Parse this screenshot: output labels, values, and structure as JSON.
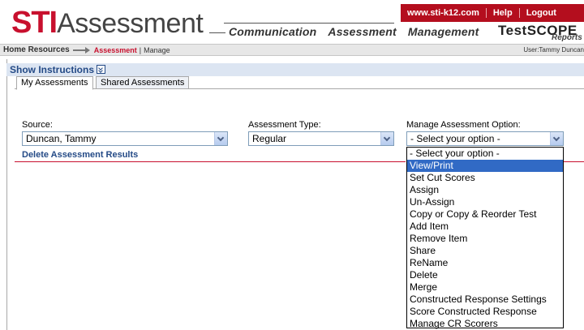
{
  "header": {
    "logo_bold": "STI",
    "logo_rest": "Assessment",
    "top_links": [
      "www.sti-k12.com",
      "Help",
      "Logout"
    ],
    "nav": [
      "Communication",
      "Assessment",
      "Management"
    ],
    "testscope": "TestSCOPE",
    "testscope_sub": "Reports"
  },
  "breadcrumb": {
    "home": "Home",
    "resources": "Resources",
    "current": "Assessment",
    "separator": "|",
    "page": "Manage",
    "user": "User:Tammy Duncan"
  },
  "instructions": {
    "label": "Show Instructions"
  },
  "tabs": [
    {
      "label": "My Assessments",
      "active": true
    },
    {
      "label": "Shared Assessments",
      "active": false
    }
  ],
  "form": {
    "source_label": "Source:",
    "source_value": "Duncan, Tammy",
    "type_label": "Assessment Type:",
    "type_value": "Regular",
    "option_label": "Manage Assessment Option:",
    "option_value": "- Select your option -"
  },
  "delete_link": "Delete Assessment Results",
  "dropdown_options": [
    "- Select your option -",
    "View/Print",
    "Set Cut Scores",
    "Assign",
    "Un-Assign",
    "Copy or Copy & Reorder Test",
    "Add Item",
    "Remove Item",
    "Share",
    "ReName",
    "Delete",
    "Merge",
    "Constructed Response Settings",
    "Score Constructed Response",
    "Manage CR Scorers"
  ],
  "dropdown_highlighted_index": 1,
  "colors": {
    "brand_red": "#c8102e",
    "link_blue": "#244a86",
    "highlight": "#316ac5"
  }
}
